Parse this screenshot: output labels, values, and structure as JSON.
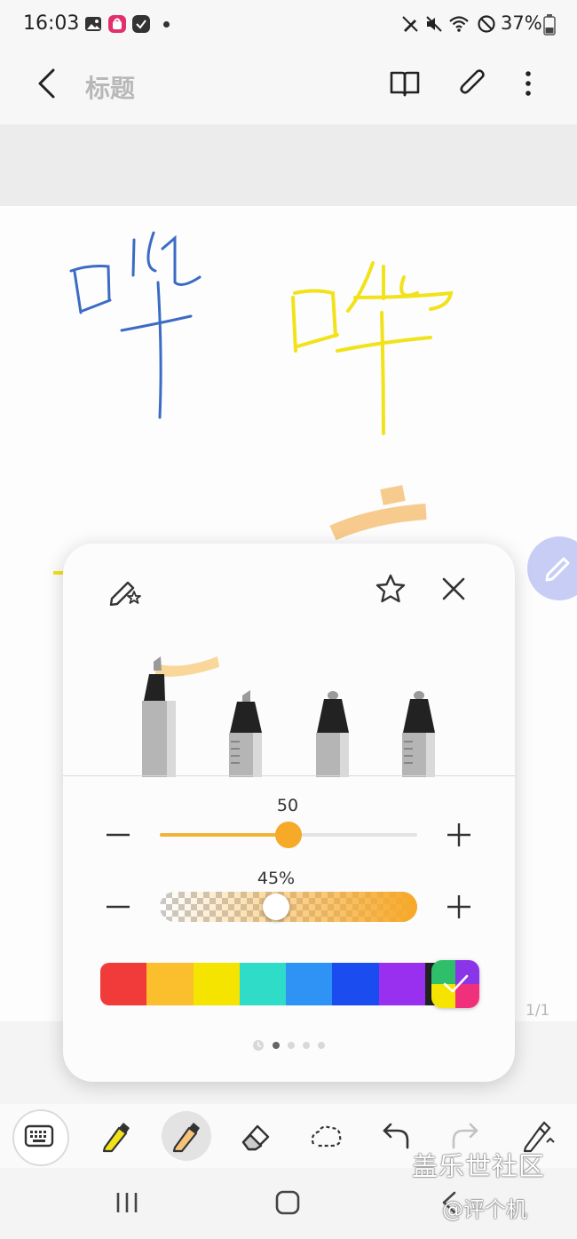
{
  "status_bar": {
    "time": "16:03",
    "battery": "37%",
    "left_icons": [
      "gallery-icon",
      "store-icon",
      "check-app-icon",
      "dot-icon"
    ],
    "right_icons": [
      "pen-icon",
      "mute-icon",
      "wifi-icon",
      "dnd-icon",
      "battery-icon"
    ]
  },
  "header": {
    "title_placeholder": "标题",
    "icons": [
      "back-icon",
      "book-icon",
      "attach-icon",
      "more-icon"
    ]
  },
  "canvas": {
    "page_indicator": "1/1",
    "ink_colors": {
      "blue": "#3b6bc4",
      "yellow": "#f2e21a",
      "orange": "#f7c37a"
    }
  },
  "pen_settings": {
    "pens": [
      "highlighter",
      "chisel-marker",
      "pen",
      "fountain-pen"
    ],
    "selected_pen": "highlighter",
    "size_value": "50",
    "size_fraction": 0.5,
    "opacity_value": "45%",
    "opacity_fraction": 0.45,
    "accent_color": "#f7a928",
    "palette": [
      "#f13a3a",
      "#fbbf2d",
      "#f5e400",
      "#2fdcc8",
      "#2f93f5",
      "#1a4cf0",
      "#9930f0",
      "#222222"
    ],
    "page_dots": 5,
    "active_dot": 1
  },
  "bottom_toolbar": {
    "tools": [
      "keyboard-icon",
      "pen-tool-icon",
      "highlighter-tool-icon",
      "eraser-icon",
      "lasso-icon",
      "undo-icon",
      "redo-icon",
      "pen-settings-icon"
    ]
  },
  "watermark": {
    "line1": "盖乐世社区",
    "line2": "@评个机"
  }
}
